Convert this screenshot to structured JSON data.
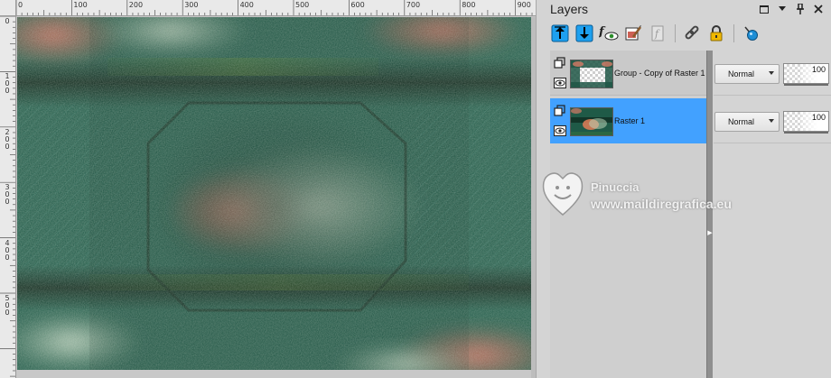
{
  "rulers": {
    "top_labels": [
      "0",
      "100",
      "200",
      "300",
      "400",
      "500",
      "600",
      "700",
      "800",
      "900"
    ],
    "left_labels": [
      "0",
      "1\n0\n0",
      "2\n0\n0",
      "3\n0\n0",
      "4\n0\n0",
      "5\n0\n0"
    ]
  },
  "watermark": {
    "name": "Pinuccia",
    "url": "www.maildiregrafica.eu"
  },
  "layers_panel": {
    "title": "Layers",
    "layers": [
      {
        "name": "Group - Copy of Raster 1",
        "type_icon": "group-layer-icon",
        "visibility_icon": "eye-icon",
        "blend_mode": "Normal",
        "opacity": 100,
        "selected": false
      },
      {
        "name": "Raster 1",
        "type_icon": "raster-layer-icon",
        "visibility_icon": "eye-icon",
        "blend_mode": "Normal",
        "opacity": 100,
        "selected": true
      }
    ],
    "toolbar_icons": [
      "move-layer-up-icon",
      "move-layer-down-icon",
      "visibility-toggle-icon",
      "edit-layer-icon",
      "locked-layers-icon",
      "link-layers-icon",
      "lock-icon",
      "properties-icon"
    ],
    "window_icons": [
      "restore-icon",
      "menu-arrow-icon",
      "pin-icon",
      "close-icon"
    ],
    "colors": {
      "selected_row": "#42a1ff",
      "panel_bg": "#d4d4d4",
      "splitter": "#8f8f8f"
    }
  }
}
